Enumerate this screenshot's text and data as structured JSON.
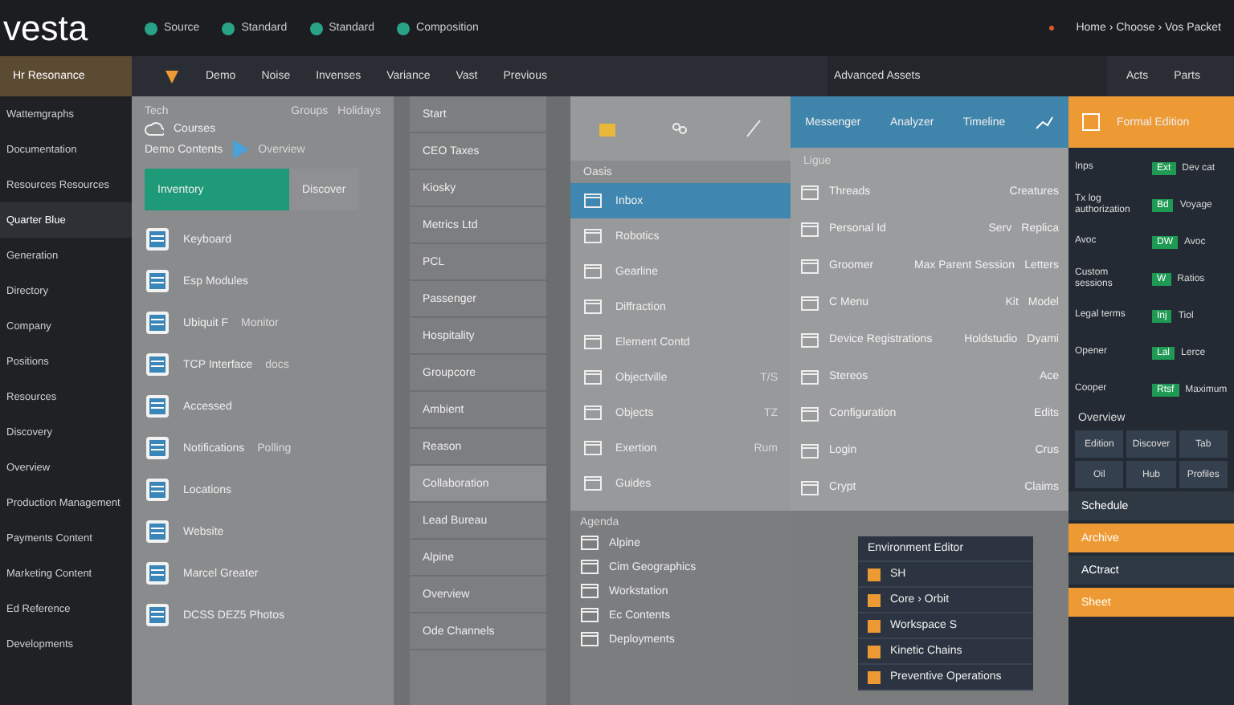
{
  "top_bar": {
    "logo": "vesta",
    "nav": [
      {
        "label": "Source"
      },
      {
        "label": "Standard"
      },
      {
        "label": "Standard"
      },
      {
        "label": "Composition"
      }
    ],
    "breadcrumb": "Home › Choose › Vos Packet"
  },
  "sidebar": {
    "title": "Hr Resonance",
    "items": [
      {
        "label": "Wattemgraphs",
        "selected": false
      },
      {
        "label": "Documentation",
        "selected": false
      },
      {
        "label": "Resources Resources",
        "selected": false
      },
      {
        "label": "Quarter Blue",
        "selected": true
      },
      {
        "label": "Generation",
        "selected": false
      },
      {
        "label": "Directory",
        "selected": false
      },
      {
        "label": "Company",
        "selected": false
      },
      {
        "label": "Positions",
        "selected": false
      },
      {
        "label": "Resources",
        "selected": false
      },
      {
        "label": "Discovery",
        "selected": false
      },
      {
        "label": "Overview",
        "selected": false
      },
      {
        "label": "Production Management",
        "selected": false
      },
      {
        "label": "Payments Content",
        "selected": false
      },
      {
        "label": "Marketing Content",
        "selected": false
      },
      {
        "label": "Ed Reference",
        "selected": false
      },
      {
        "label": "Developments",
        "selected": false
      }
    ]
  },
  "toolbar": {
    "items": [
      "Demo",
      "Noise",
      "Invenses",
      "Variance",
      "Vast",
      "Previous"
    ],
    "section_title": "Advanced Assets",
    "right_items": [
      "Acts",
      "Parts"
    ]
  },
  "panel_1": {
    "label": "Tech",
    "header_links": [
      "Groups",
      "Holidays"
    ],
    "courses": "Courses",
    "title": "Demo Contents",
    "overview": "Overview",
    "tabs": [
      {
        "label": "Inventory",
        "selected": true
      },
      {
        "label": "Discover",
        "selected": false
      }
    ],
    "rows": [
      {
        "label": "Keyboard"
      },
      {
        "label": "Esp Modules"
      },
      {
        "label": "Ubiquit F",
        "detail": "Monitor"
      },
      {
        "label": "TCP Interface",
        "detail": "docs"
      },
      {
        "label": "Accessed"
      },
      {
        "label": "Notifications",
        "detail": "Polling"
      },
      {
        "label": "Locations"
      },
      {
        "label": "Website"
      },
      {
        "label": "Marcel Greater"
      },
      {
        "label": "DCSS DEZ5 Photos"
      }
    ]
  },
  "panel_2": {
    "items": [
      {
        "label": "Start",
        "selected": false
      },
      {
        "label": "CEO Taxes",
        "selected": false
      },
      {
        "label": "Kiosky",
        "selected": false
      },
      {
        "label": "Metrics Ltd",
        "selected": false
      },
      {
        "label": "PCL",
        "selected": false
      },
      {
        "label": "Passenger",
        "selected": false
      },
      {
        "label": "Hospitality",
        "selected": false
      },
      {
        "label": "Groupcore",
        "selected": false
      },
      {
        "label": "Ambient",
        "selected": false
      },
      {
        "label": "Reason",
        "selected": false
      },
      {
        "label": "Collaboration",
        "selected": true
      },
      {
        "label": "Lead Bureau",
        "selected": false
      },
      {
        "label": "Alpine",
        "selected": false
      },
      {
        "label": "Overview",
        "selected": false
      },
      {
        "label": "Ode Channels",
        "selected": false
      }
    ]
  },
  "panel_3": {
    "label": "Oasis",
    "items": [
      {
        "label": "Inbox",
        "selected": true
      },
      {
        "label": "Robotics",
        "selected": false
      },
      {
        "label": "Gearline",
        "selected": false
      },
      {
        "label": "Diffraction",
        "selected": false
      },
      {
        "label": "Element Contd",
        "selected": false
      },
      {
        "label": "Objectville",
        "detail": "T/S",
        "selected": false
      },
      {
        "label": "Objects",
        "detail": "TZ",
        "selected": false
      },
      {
        "label": "Exertion",
        "detail": "Rum",
        "selected": false
      },
      {
        "label": "Guides",
        "selected": false
      }
    ],
    "section_label": "Agenda",
    "section_items": [
      "Alpine",
      "Cim Geographics",
      "Workstation",
      "Ec Contents",
      "Deployments"
    ]
  },
  "panel_4": {
    "header_items": [
      "Messenger",
      "Analyzer",
      "Timeline"
    ],
    "label": "Ligue",
    "rows": [
      {
        "cells": [
          "Threads",
          "Creatures"
        ]
      },
      {
        "cells": [
          "Personal Id",
          "Serv",
          "Replica"
        ]
      },
      {
        "cells": [
          "Groomer",
          "Max Parent Session",
          "Letters"
        ]
      },
      {
        "cells": [
          "C Menu",
          "Kit",
          "Model"
        ]
      },
      {
        "cells": [
          "Device Registrations",
          "Holdstudio",
          "Dyami"
        ]
      },
      {
        "cells": [
          "Stereos",
          "Ace"
        ]
      },
      {
        "cells": [
          "Configuration",
          "Edits"
        ]
      },
      {
        "cells": [
          "Login",
          "Crus"
        ]
      },
      {
        "cells": [
          "Crypt",
          "Claims"
        ]
      }
    ]
  },
  "popup": {
    "title": "Environment Editor",
    "items": [
      "SH",
      "Core › Orbit",
      "Workspace S",
      "Kinetic Chains",
      "Preventive Operations"
    ]
  },
  "right_panel": {
    "header": "Formal Edition",
    "rows": [
      {
        "label": "Inps",
        "badge": "Ext",
        "value": "Dev cat"
      },
      {
        "label": "Tx log authorization",
        "badge": "Bd",
        "value": "Voyage"
      },
      {
        "label": "Avoc",
        "badge": "DW",
        "value": "Avoc"
      },
      {
        "label": "Custom sessions",
        "badge": "W",
        "value": "Ratios"
      },
      {
        "label": "Legal terms",
        "badge": "Inj",
        "value": "Tiol"
      },
      {
        "label": "Opener",
        "badge": "Lal",
        "value": "Lerce"
      },
      {
        "label": "Cooper",
        "badge": "Rtsf",
        "value": "Maximum"
      }
    ],
    "section_title": "Overview",
    "tiles": [
      "Edition",
      "Discover",
      "Tab",
      "Oil",
      "Hub",
      "Profiles"
    ],
    "bars": [
      {
        "label": "Schedule",
        "kind": "dark"
      },
      {
        "label": "Archive",
        "kind": "orange"
      },
      {
        "label": "ACtract",
        "kind": "dark"
      },
      {
        "label": "Sheet",
        "kind": "orange"
      }
    ]
  }
}
